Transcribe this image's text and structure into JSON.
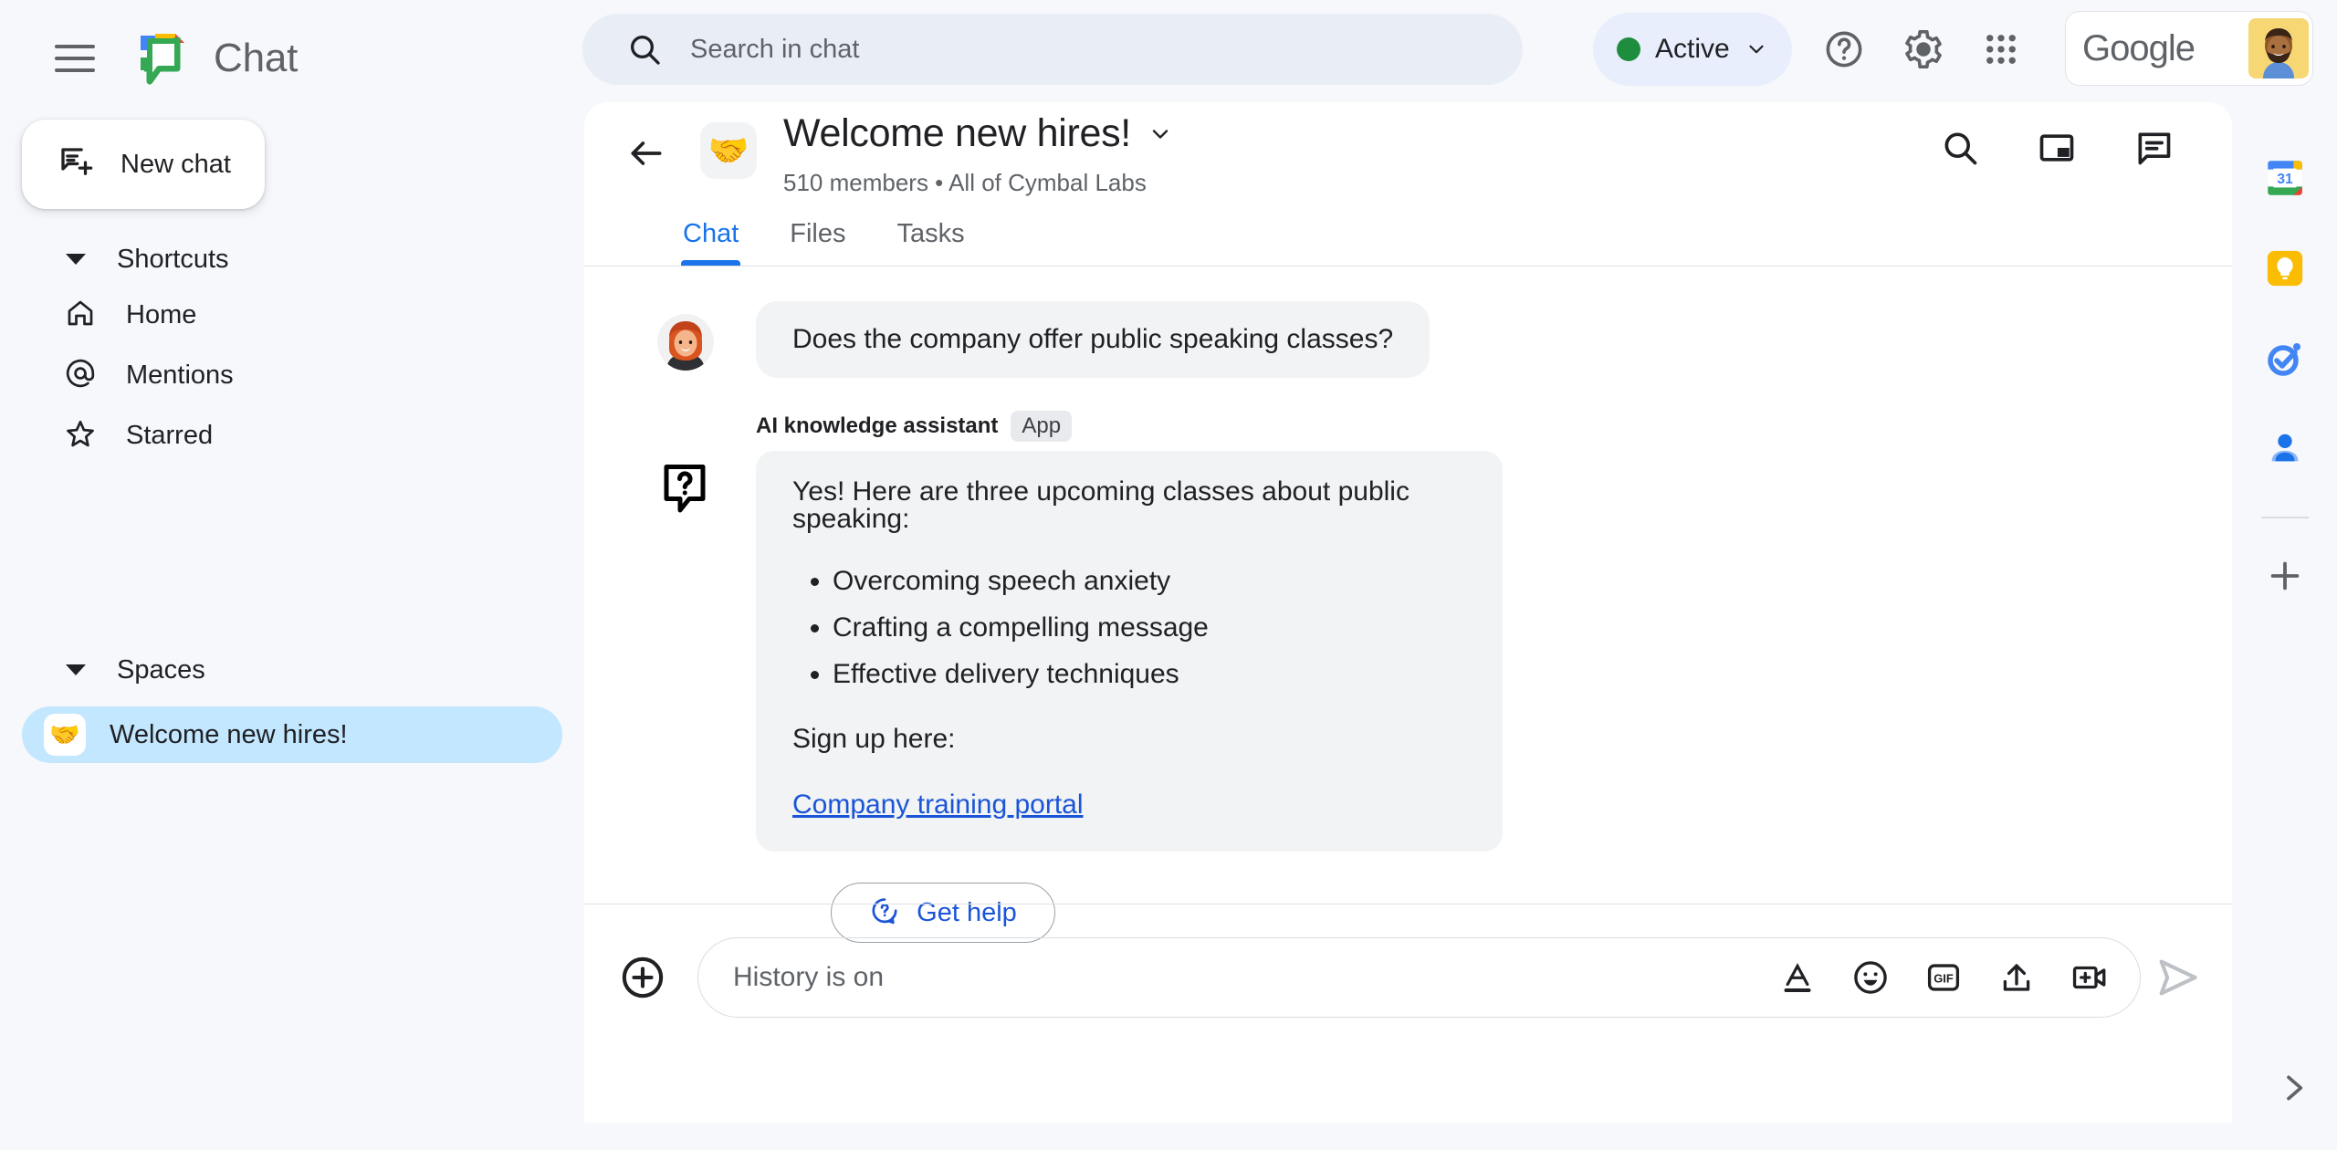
{
  "topbar": {
    "menu_icon": "hamburger-icon",
    "app_name": "Chat",
    "search": {
      "placeholder": "Search in chat",
      "icon": "search-icon"
    },
    "status": {
      "label": "Active",
      "color": "#1e8e3e",
      "chevron_icon": "chevron-down-icon"
    },
    "help_icon": "help-circle-icon",
    "settings_icon": "gear-icon",
    "apps_icon": "apps-grid-icon",
    "account": {
      "brand": "Google",
      "avatar_icon": "avatar"
    }
  },
  "sidebar": {
    "new_chat": {
      "label": "New chat",
      "icon": "new-chat-icon"
    },
    "shortcuts": {
      "title": "Shortcuts",
      "items": [
        {
          "label": "Home",
          "icon": "home-icon"
        },
        {
          "label": "Mentions",
          "icon": "at-icon"
        },
        {
          "label": "Starred",
          "icon": "star-icon"
        }
      ]
    },
    "spaces": {
      "title": "Spaces",
      "items": [
        {
          "label": "Welcome new hires!",
          "emoji": "🤝",
          "selected": true
        }
      ]
    }
  },
  "space_header": {
    "back_icon": "back-arrow-icon",
    "emoji": "🤝",
    "title": "Welcome new hires!",
    "title_chevron_icon": "chevron-down-icon",
    "subtitle": "510 members  •  All of Cymbal Labs",
    "actions": [
      "search-icon",
      "picture-in-picture-icon",
      "threads-icon"
    ]
  },
  "tabs": [
    {
      "label": "Chat",
      "active": true
    },
    {
      "label": "Files",
      "active": false
    },
    {
      "label": "Tasks",
      "active": false
    }
  ],
  "messages": {
    "user": {
      "text": "Does the company offer public speaking classes?",
      "avatar_icon": "user-avatar"
    },
    "bot": {
      "name": "AI knowledge assistant",
      "badge": "App",
      "icon": "question-bubble-icon",
      "intro": "Yes! Here are three upcoming classes about public speaking:",
      "items": [
        "Overcoming speech anxiety",
        "Crafting a compelling message",
        "Effective delivery techniques"
      ],
      "signup_text": "Sign up here:",
      "link_text": "Company training portal",
      "link_color": "#1a55d7"
    },
    "get_help": {
      "label": "Get help",
      "icon": "help-bubble-icon"
    }
  },
  "composer": {
    "plus_icon": "add-circle-icon",
    "placeholder": "History is on",
    "value": "",
    "tools": [
      {
        "name": "format-text-icon",
        "label": "A"
      },
      {
        "name": "emoji-icon",
        "label": ""
      },
      {
        "name": "gif-icon",
        "label": "GIF"
      },
      {
        "name": "upload-icon",
        "label": ""
      },
      {
        "name": "add-video-icon",
        "label": ""
      }
    ],
    "send_icon": "send-icon"
  },
  "rail": {
    "items": [
      {
        "name": "calendar-icon",
        "label": "31"
      },
      {
        "name": "keep-icon",
        "label": ""
      },
      {
        "name": "tasks-icon",
        "label": ""
      },
      {
        "name": "contacts-icon",
        "label": ""
      }
    ],
    "add_icon": "plus-icon",
    "expand_icon": "chevron-right-icon"
  }
}
